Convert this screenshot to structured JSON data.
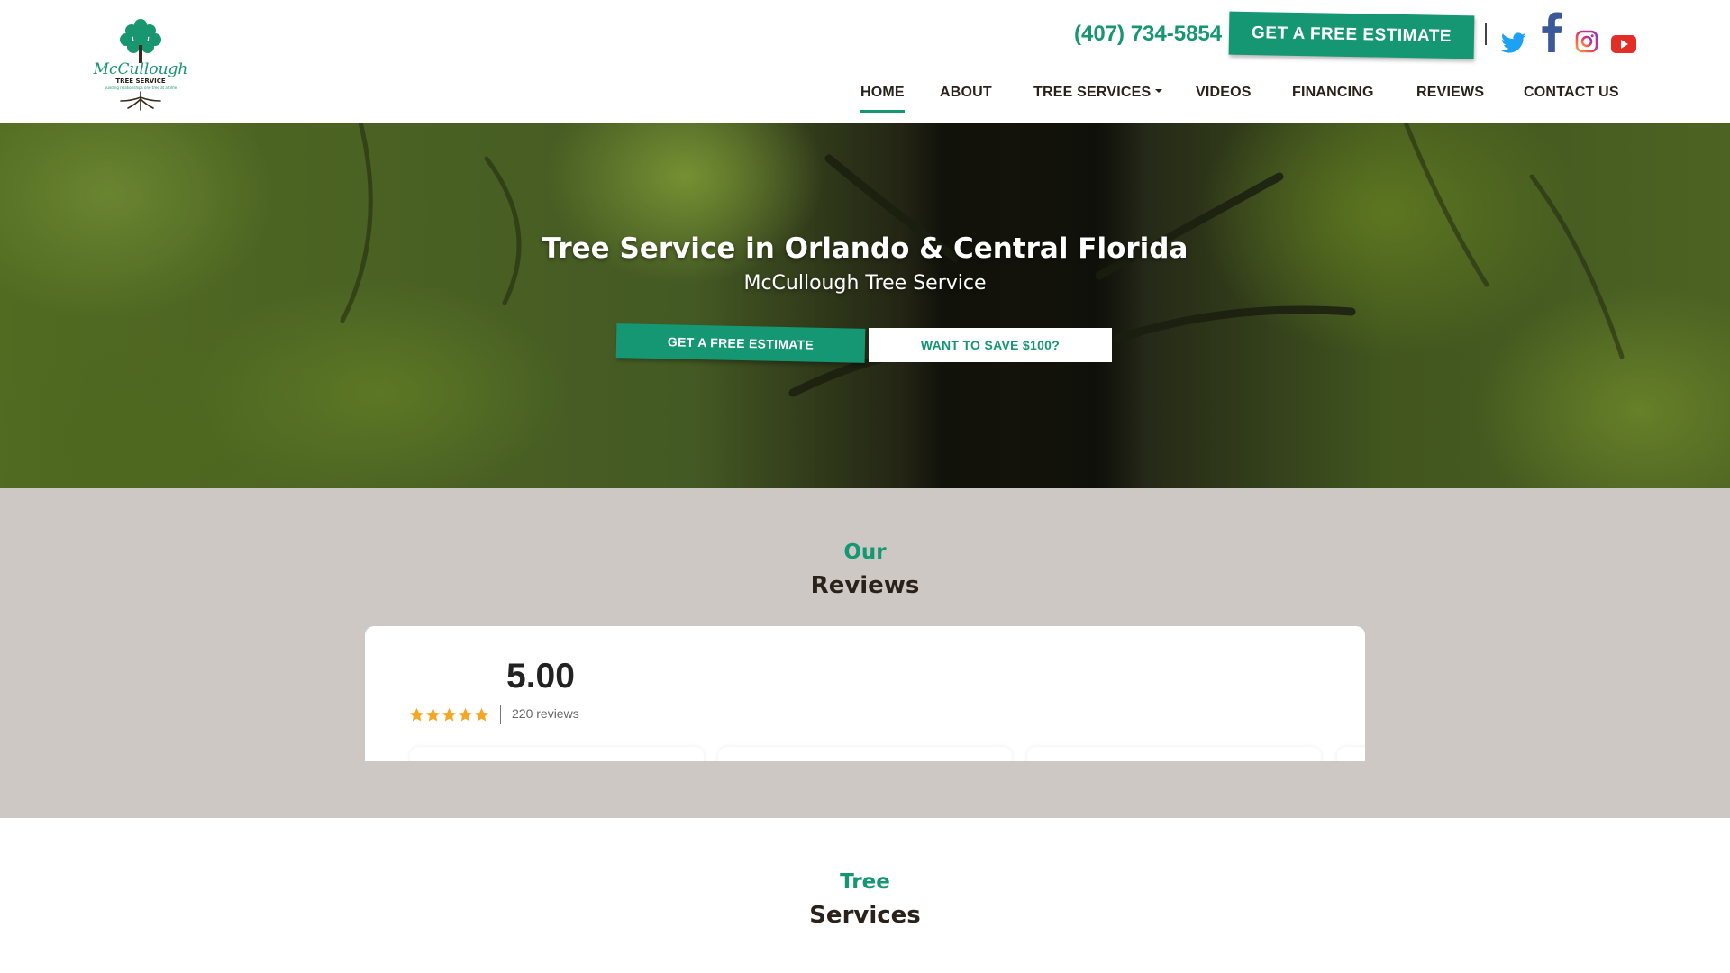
{
  "header": {
    "logo_alt": "McCullough Tree Service - building relationships one tree at a time",
    "phone": "(407) 734-5854",
    "estimate_button": "GET A FREE ESTIMATE",
    "social": {
      "twitter": "twitter-icon",
      "facebook": "facebook-icon",
      "instagram": "instagram-icon",
      "youtube": "youtube-icon"
    },
    "nav": [
      {
        "label": "HOME",
        "active": true
      },
      {
        "label": "ABOUT",
        "active": false
      },
      {
        "label": "TREE SERVICES",
        "active": false,
        "has_dropdown": true
      },
      {
        "label": "VIDEOS",
        "active": false
      },
      {
        "label": "FINANCING",
        "active": false
      },
      {
        "label": "REVIEWS",
        "active": false
      },
      {
        "label": "CONTACT US",
        "active": false
      }
    ]
  },
  "hero": {
    "title": "Tree Service in Orlando & Central Florida",
    "subtitle": "McCullough Tree Service",
    "primary_button": "GET A FREE ESTIMATE",
    "secondary_button": "WANT TO SAVE $100?"
  },
  "reviews": {
    "kicker": "Our",
    "heading": "Reviews",
    "rating": "5.00",
    "stars": 5,
    "count_text": "220 reviews"
  },
  "services": {
    "kicker": "Tree",
    "heading": "Services"
  },
  "colors": {
    "brand_green": "#149772",
    "dark_text": "#2b211b",
    "reviews_bg": "#cdc8c4",
    "star": "#f5a623",
    "facebook": "#3b5998",
    "twitter": "#1da1f2",
    "youtube": "#e52d27"
  }
}
